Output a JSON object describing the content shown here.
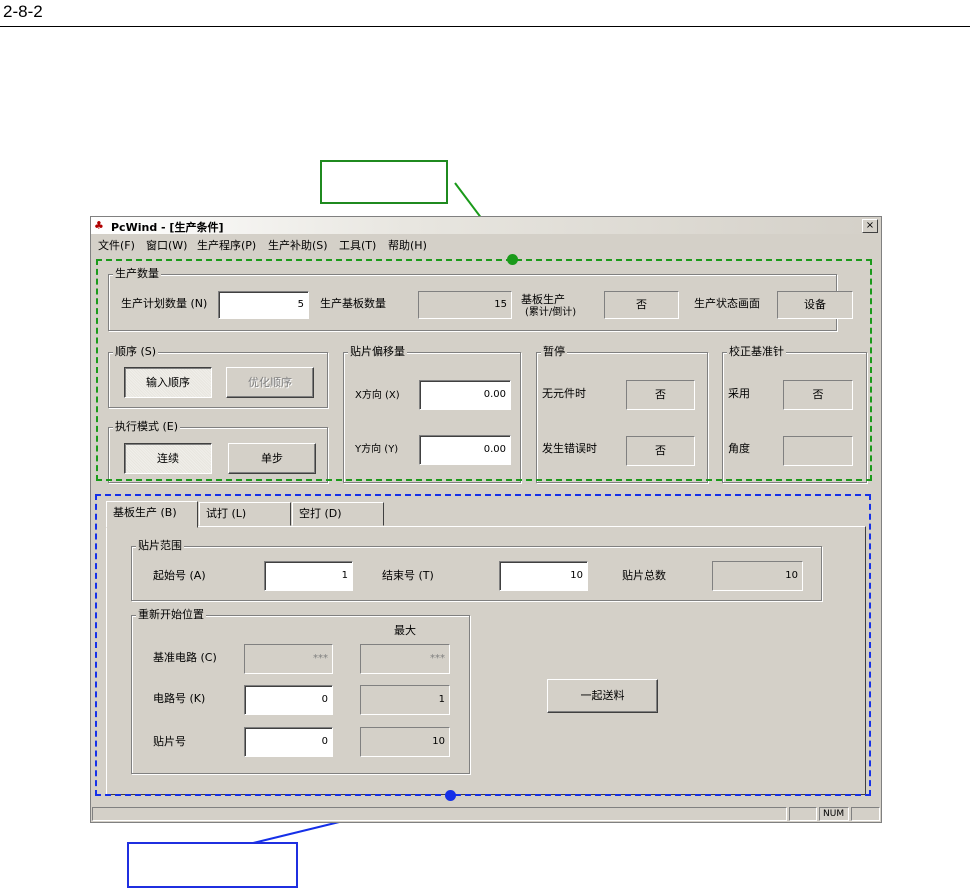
{
  "page": {
    "section_number": "2-8-2"
  },
  "colors": {
    "green_highlight": "#1a9a1a",
    "blue_highlight": "#1530e8",
    "window_face": "#d4d0c8"
  },
  "window": {
    "title": "PcWind - [生产条件]",
    "app_icon": "pcwind-app-icon",
    "close_glyph": "×",
    "menu": [
      "文件(F)",
      "窗口(W)",
      "生产程序(P)",
      "生产补助(S)",
      "工具(T)",
      "帮助(H)"
    ]
  },
  "production_qty": {
    "legend": "生产数量",
    "plan_label": "生产计划数量 (N)",
    "plan_value": "5",
    "boards_label": "生产基板数量",
    "boards_value": "15",
    "board_prod_label_1": "基板生产",
    "board_prod_label_2": "(累计/倒计)",
    "board_prod_value": "否",
    "status_screen_label": "生产状态画面",
    "status_screen_value": "设备"
  },
  "sequence": {
    "legend": "顺序 (S)",
    "input_btn": "输入顺序",
    "optimize_btn": "优化顺序"
  },
  "exec_mode": {
    "legend": "执行模式 (E)",
    "continuous_btn": "连续",
    "step_btn": "单步"
  },
  "offset": {
    "legend": "贴片偏移量",
    "x_label": "X方向 (X)",
    "x_value": "0.00",
    "y_label": "Y方向 (Y)",
    "y_value": "0.00"
  },
  "pause": {
    "legend": "暂停",
    "no_part_label": "无元件时",
    "no_part_value": "否",
    "error_label": "发生错误时",
    "error_value": "否"
  },
  "calib_pin": {
    "legend": "校正基准针",
    "use_label": "采用",
    "use_value": "否",
    "angle_label": "角度",
    "angle_value": ""
  },
  "tabs": [
    "基板生产 (B)",
    "试打 (L)",
    "空打 (D)"
  ],
  "placement_range": {
    "legend": "贴片范围",
    "start_label": "起始号 (A)",
    "start_value": "1",
    "end_label": "结束号 (T)",
    "end_value": "10",
    "total_label": "贴片总数",
    "total_value": "10"
  },
  "restart": {
    "legend": "重新开始位置",
    "max_header": "最大",
    "base_circuit_label": "基准电路 (C)",
    "base_circuit_value": "***",
    "base_circuit_max": "***",
    "circuit_label": "电路号 (K)",
    "circuit_value": "0",
    "circuit_max": "1",
    "placement_label": "贴片号",
    "placement_value": "0",
    "placement_max": "10"
  },
  "feed_button": "一起送料",
  "statusbar": {
    "num": "NUM"
  }
}
